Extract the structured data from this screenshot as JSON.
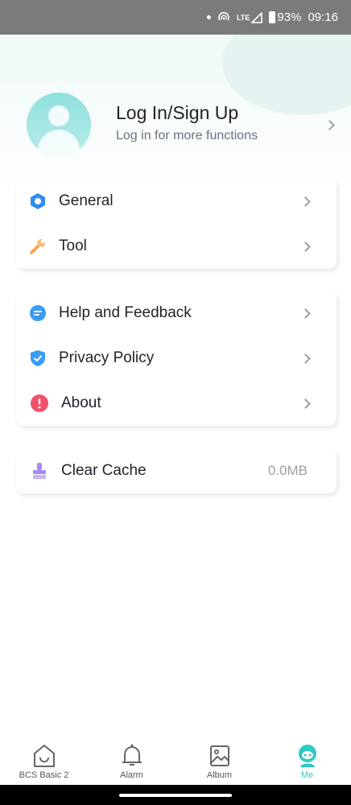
{
  "status_bar": {
    "network": "LTE",
    "battery": "93%",
    "time": "09:16"
  },
  "profile": {
    "title": "Log In/Sign Up",
    "subtitle": "Log in for more functions"
  },
  "group1": [
    {
      "label": "General",
      "icon": "gear-hex-icon",
      "color": "#2f8cf0"
    },
    {
      "label": "Tool",
      "icon": "wrench-icon",
      "color": "#f5a64a"
    }
  ],
  "group2": [
    {
      "label": "Help and Feedback",
      "icon": "message-icon",
      "color": "#3a9cf2"
    },
    {
      "label": "Privacy Policy",
      "icon": "shield-check-icon",
      "color": "#3a9cf2"
    },
    {
      "label": "About",
      "icon": "info-icon",
      "color": "#f0516b"
    }
  ],
  "cache": {
    "label": "Clear Cache",
    "value": "0.0MB",
    "icon": "brush-icon",
    "color": "#a78bf2"
  },
  "tabs": [
    {
      "label": "BCS Basic 2",
      "icon": "home-icon"
    },
    {
      "label": "Alarm",
      "icon": "bell-icon"
    },
    {
      "label": "Album",
      "icon": "image-icon"
    },
    {
      "label": "Me",
      "icon": "me-icon",
      "active": true
    }
  ],
  "colors": {
    "accent": "#2ec9c1",
    "status_bar": "#7b7b7b"
  }
}
